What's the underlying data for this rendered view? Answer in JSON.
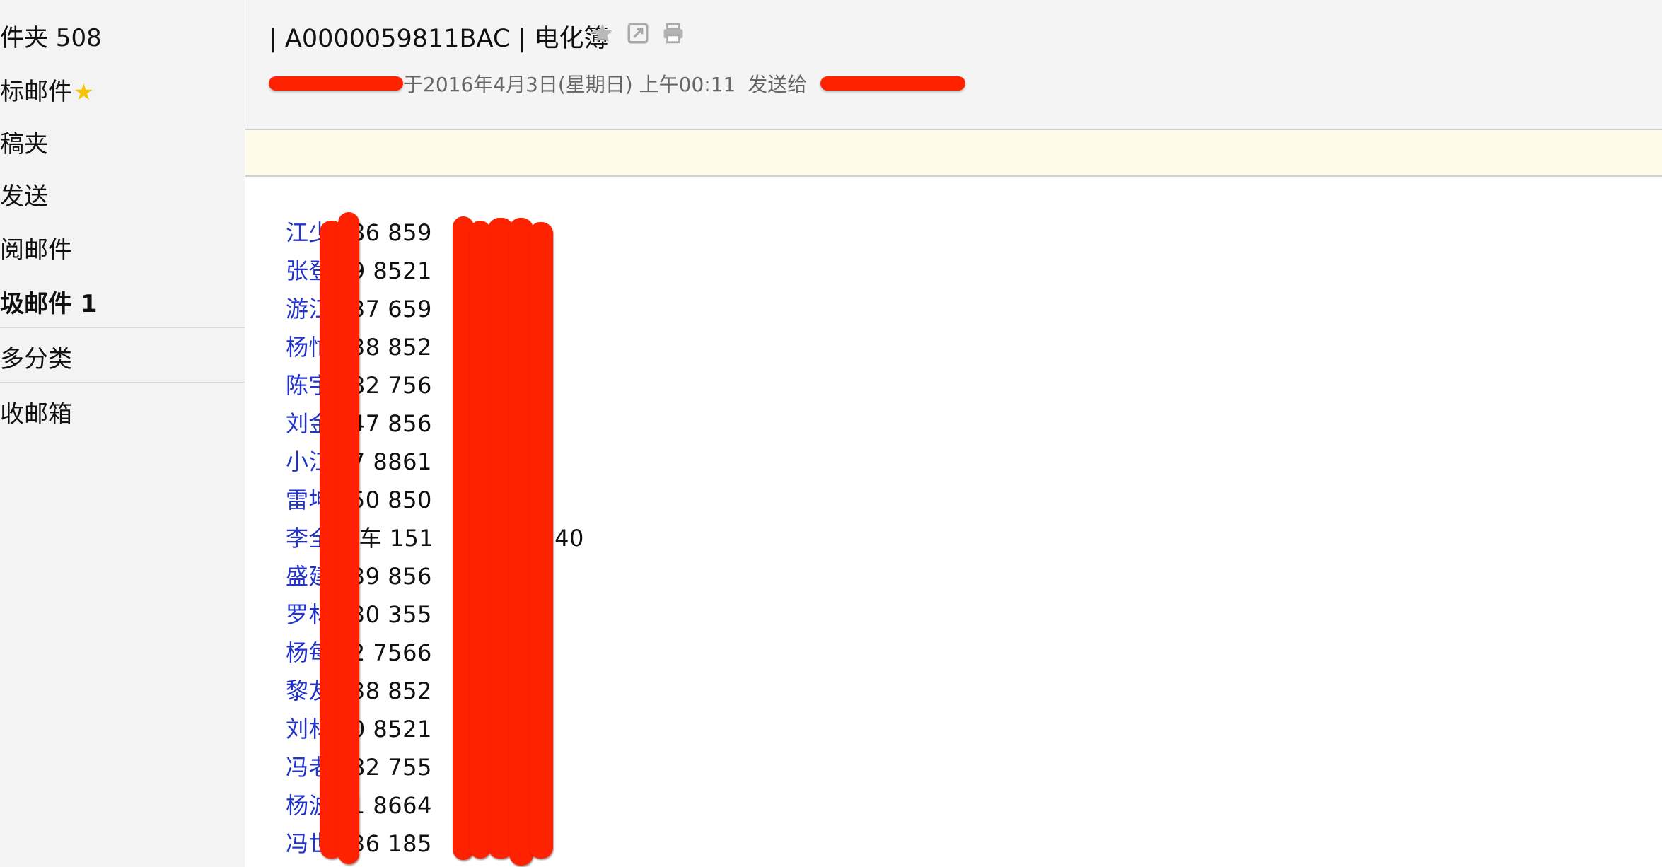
{
  "sidebar": {
    "items": [
      {
        "label": "件夹 508"
      },
      {
        "label": "标邮件"
      },
      {
        "label": "稿夹"
      },
      {
        "label": "发送"
      },
      {
        "label": "阅邮件"
      },
      {
        "label": "圾邮件 1"
      },
      {
        "label": "多分类"
      },
      {
        "label": "收邮箱"
      }
    ],
    "star_icon": "★"
  },
  "email": {
    "subject": "| A0000059811BAC | 电化簿",
    "meta_date": "于2016年4月3日(星期日) 上午00:11",
    "meta_sendto": "发送给",
    "icons": [
      "star-icon",
      "pop-out-icon",
      "print-icon"
    ]
  },
  "contacts": [
    {
      "name": "江少",
      "phone": "186 859"
    },
    {
      "name": "张登",
      "phone": "39 8521"
    },
    {
      "name": "游江",
      "phone": "137 659"
    },
    {
      "name": "杨忙",
      "phone": "138 852"
    },
    {
      "name": "陈宇",
      "phone": "182 756"
    },
    {
      "name": "刘金",
      "phone": "147 856"
    },
    {
      "name": "小江",
      "phone": "87 8861"
    },
    {
      "name": "雷坤",
      "phone": "150 850"
    },
    {
      "name": "李全",
      "phone": "铲车 151",
      "tail": "840"
    },
    {
      "name": "盛建",
      "phone": "139 856"
    },
    {
      "name": "罗林",
      "phone": "130 355"
    },
    {
      "name": "杨每",
      "phone": "82 7566"
    },
    {
      "name": "黎友",
      "phone": "138 852"
    },
    {
      "name": "刘林",
      "phone": "80 8521"
    },
    {
      "name": "冯老",
      "phone": "182 755"
    },
    {
      "name": "杨波",
      "phone": "51 8664"
    },
    {
      "name": "冯世",
      "phone": "136 185"
    }
  ],
  "colors": {
    "link": "#2233cc",
    "redaction": "#ff2200",
    "notice_bg": "#fffdea",
    "sidebar_bg": "#f3f3f3",
    "star": "#f4c400"
  }
}
